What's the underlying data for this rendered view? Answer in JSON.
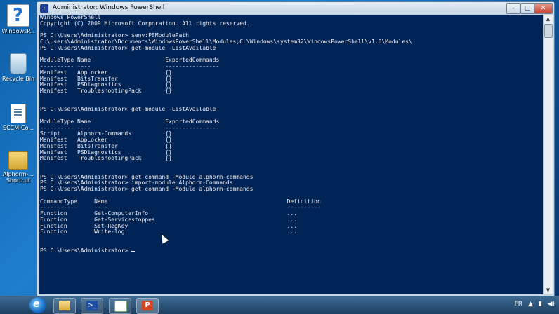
{
  "desktop": {
    "icons": [
      {
        "label": "WindowsP...",
        "icon": "help-icon"
      },
      {
        "label": "Recycle Bin",
        "icon": "recycle-bin-icon"
      },
      {
        "label": "SCCM-Co...",
        "icon": "document-icon"
      },
      {
        "label": "Alphorm-... Shortcut",
        "icon": "folder-shortcut-icon"
      }
    ]
  },
  "window": {
    "title": "Administrator: Windows PowerShell",
    "minimize": "–",
    "maximize": "□",
    "close": "✕"
  },
  "console": {
    "lines": [
      "Windows PowerShell",
      "Copyright (C) 2009 Microsoft Corporation. All rights reserved.",
      "",
      "PS C:\\Users\\Administrator> $env:PSModulePath",
      "C:\\Users\\Administrator\\Documents\\WindowsPowerShell\\Modules;C:\\Windows\\system32\\WindowsPowerShell\\v1.0\\Modules\\",
      "PS C:\\Users\\Administrator> get-module -ListAvailable",
      "",
      "ModuleType Name                      ExportedCommands",
      "---------- ----                      ----------------",
      "Manifest   AppLocker                 {}",
      "Manifest   BitsTransfer              {}",
      "Manifest   PSDiagnostics             {}",
      "Manifest   TroubleshootingPack       {}",
      "",
      "",
      "PS C:\\Users\\Administrator> get-module -ListAvailable",
      "",
      "ModuleType Name                      ExportedCommands",
      "---------- ----                      ----------------",
      "Script     Alphorm-Commands          {}",
      "Manifest   AppLocker                 {}",
      "Manifest   BitsTransfer              {}",
      "Manifest   PSDiagnostics             {}",
      "Manifest   TroubleshootingPack       {}",
      "",
      "",
      "PS C:\\Users\\Administrator> get-command -Module alphorm-commands",
      "PS C:\\Users\\Administrator> import-module Alphorm-Commands",
      "PS C:\\Users\\Administrator> get-command -Module alphorm-commands",
      "",
      "CommandType     Name                                                     Definition",
      "-----------     ----                                                     ----------",
      "Function        Get-ComputerInfo                                         ...",
      "Function        Get-Servicestoppes                                       ...",
      "Function        Set-RegKey                                               ...",
      "Function        Write-log                                                ...",
      "",
      "",
      "PS C:\\Users\\Administrator> "
    ]
  },
  "taskbar": {
    "start": "e",
    "buttons": [
      "windows-explorer",
      "powershell",
      "document",
      "powerpoint"
    ],
    "ps_glyph": ">_",
    "ppt_glyph": "P",
    "tray": [
      "FR",
      "▲",
      "▮",
      "◀)"
    ]
  }
}
